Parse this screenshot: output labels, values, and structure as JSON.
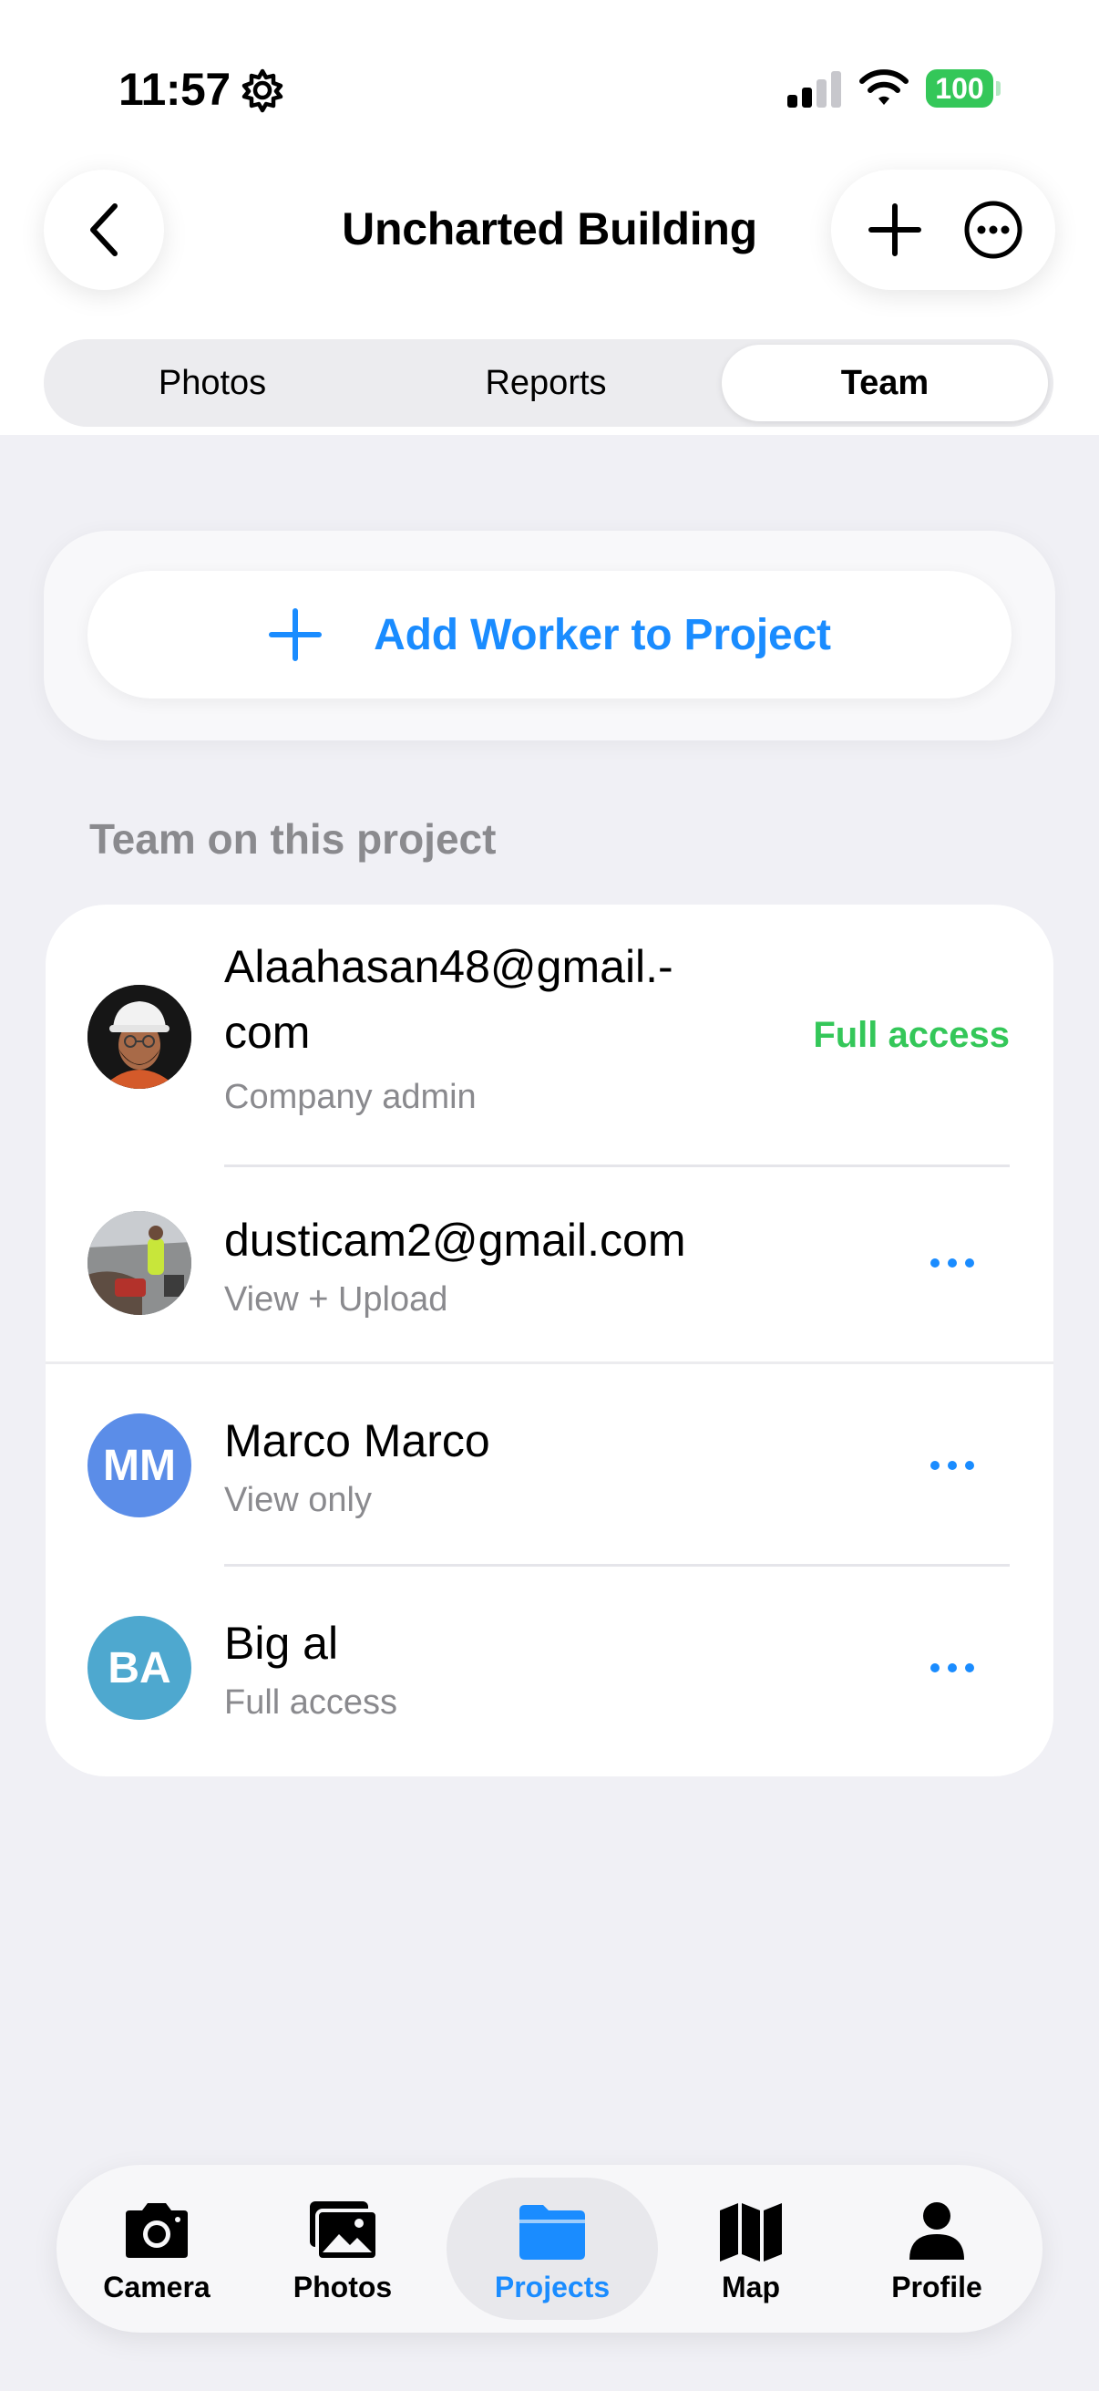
{
  "status_bar": {
    "time": "11:57",
    "battery": "100"
  },
  "header": {
    "title": "Uncharted Building"
  },
  "segments": {
    "items": [
      {
        "label": "Photos",
        "selected": false
      },
      {
        "label": "Reports",
        "selected": false
      },
      {
        "label": "Team",
        "selected": true
      }
    ]
  },
  "add_worker": {
    "label": "Add Worker to Project"
  },
  "team": {
    "section_title": "Team on this project",
    "members": [
      {
        "name_line1": "Alaahasan48@gmail.-",
        "name_line2": "com",
        "role": "Company admin",
        "access": "Full access",
        "avatar": "photo-hardhat"
      },
      {
        "name": "dusticam2@gmail.com",
        "role": "View + Upload",
        "avatar": "photo-site"
      },
      {
        "name": "Marco Marco",
        "role": "View only",
        "initials": "MM",
        "avatar_color": "#5b8de8"
      },
      {
        "name": "Big al",
        "role": "Full access",
        "initials": "BA",
        "avatar_color": "#4ea8cf"
      }
    ]
  },
  "tabbar": {
    "items": [
      {
        "label": "Camera",
        "icon": "camera-icon",
        "active": false
      },
      {
        "label": "Photos",
        "icon": "photos-icon",
        "active": false
      },
      {
        "label": "Projects",
        "icon": "folder-icon",
        "active": true
      },
      {
        "label": "Map",
        "icon": "map-icon",
        "active": false
      },
      {
        "label": "Profile",
        "icon": "person-icon",
        "active": false
      }
    ]
  },
  "colors": {
    "accent": "#1a8cff",
    "success": "#34c759",
    "secondary_text": "#8a8a8e",
    "background": "#f0f0f5"
  }
}
